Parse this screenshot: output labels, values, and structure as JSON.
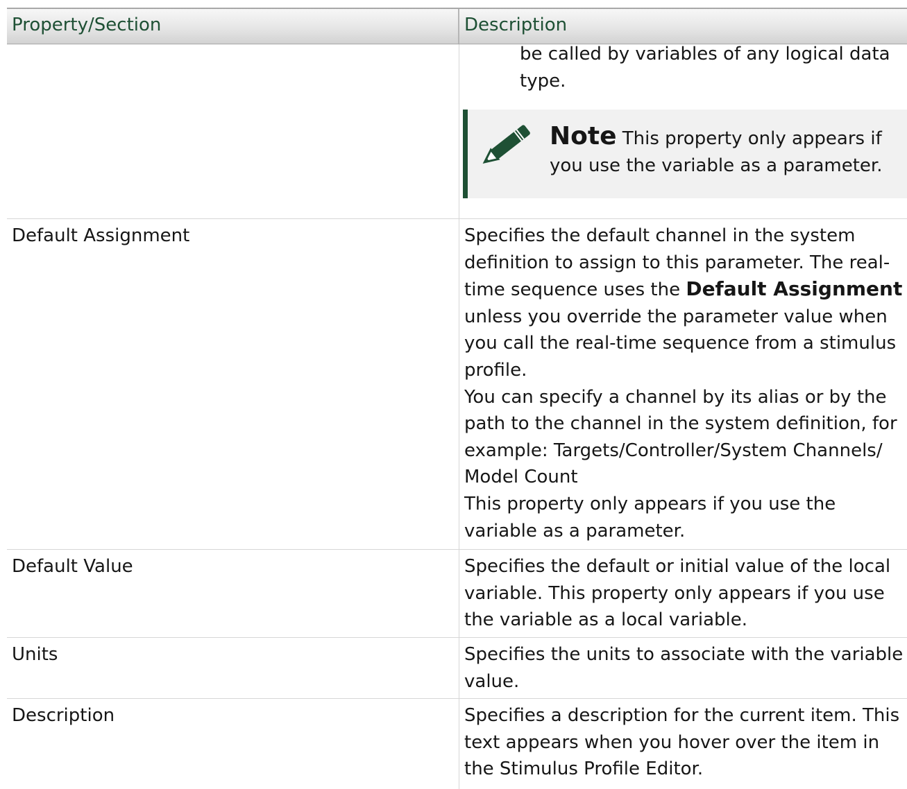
{
  "table": {
    "headers": {
      "property": "Property/Section",
      "description": "Description"
    },
    "continued_row": {
      "lines": [
        "be called by variables of any logical data",
        "type."
      ],
      "note": {
        "label": "Note",
        "line1": " This property only appears if",
        "line2": "you use the variable as a parameter."
      }
    },
    "rows": [
      {
        "property": "Default Assignment",
        "description_lines": [
          "Specifies the default channel in the system",
          "definition to assign to this parameter. The real-"
        ],
        "inline_prefix": "time sequence uses the ",
        "inline_bold": "Default Assignment",
        "description_lines_after": [
          "unless you override the parameter value when",
          "you call the real-time sequence from a stimulus",
          "profile.",
          "You can specify a channel by its alias or by the",
          "path to the channel in the system definition, for",
          "example: Targets/Controller/System Channels/",
          "Model Count",
          "This property only appears if you use the",
          "variable as a parameter."
        ]
      },
      {
        "property": "Default Value",
        "description_lines": [
          "Specifies the default or initial value of the local",
          "variable. This property only appears if you use",
          "the variable as a local variable."
        ]
      },
      {
        "property": "Units",
        "description_lines": [
          "Specifies the units to associate with the variable",
          "value."
        ]
      },
      {
        "property": "Description",
        "description_lines": [
          "Specifies a description for the current item. This",
          "text appears when you hover over the item in",
          "the Stimulus Profile Editor."
        ]
      }
    ]
  },
  "icons": {
    "note": "pencil-icon",
    "accent_color": "#1e5034"
  }
}
